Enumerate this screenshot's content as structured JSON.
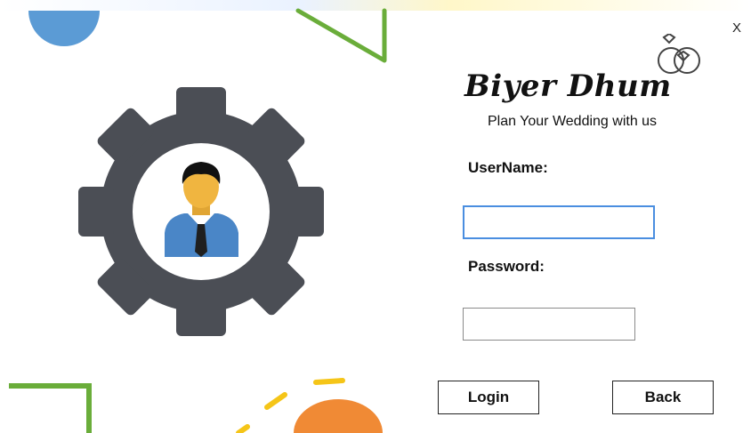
{
  "window": {
    "close_label": "X"
  },
  "brand": {
    "title": "Biyer Dhum",
    "tagline": "Plan Your Wedding with us",
    "logo_icon": "rings-icon"
  },
  "form": {
    "username_label": "UserName:",
    "username_value": "",
    "password_label": "Password:",
    "password_value": ""
  },
  "buttons": {
    "login_label": "Login",
    "back_label": "Back"
  },
  "illustration": {
    "icon": "settings-gear-user-icon"
  },
  "colors": {
    "gear": "#4b4e55",
    "accent_blue": "#5b9bd5",
    "accent_green": "#6aad3a",
    "accent_yellow": "#f5c518",
    "accent_orange": "#f08a35",
    "focus_border": "#4a8ee0"
  }
}
